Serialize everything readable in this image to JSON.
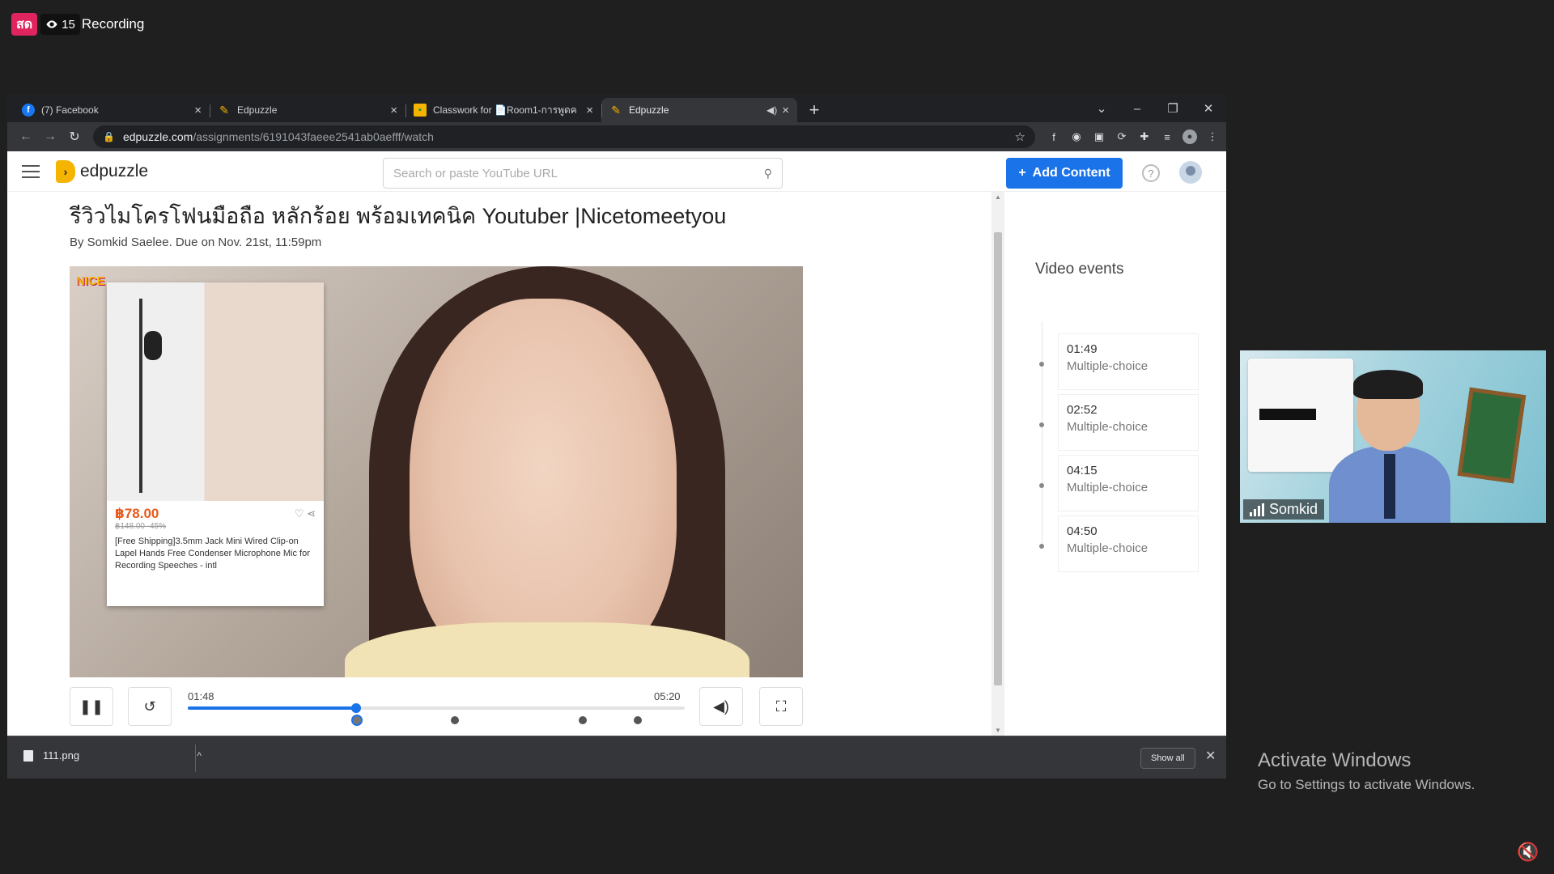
{
  "overlay": {
    "live_label": "สด",
    "viewer_count": "15",
    "recording_text": "Recording"
  },
  "browser": {
    "tabs": [
      {
        "label": "(7) Facebook",
        "favicon": "facebook-icon"
      },
      {
        "label": "Edpuzzle",
        "favicon": "edpuzzle-icon"
      },
      {
        "label": "Classwork for 📄Room1-การพูดค",
        "favicon": "google-classroom-icon"
      },
      {
        "label": "Edpuzzle",
        "favicon": "edpuzzle-icon",
        "active": true,
        "audio": true
      }
    ],
    "url_domain": "edpuzzle.com",
    "url_path": "/assignments/6191043faeee2541ab0aefff/watch"
  },
  "edpuzzle": {
    "logo_text": "edpuzzle",
    "search_placeholder": "Search or paste YouTube URL",
    "add_content_label": "Add Content",
    "help_label": "?",
    "video_title": "รีวิวไมโครโฟนมือถือ หลักร้อย พร้อมเทคนิค Youtuber |Nicetomeetyou",
    "byline": "By Somkid Saelee. Due on Nov. 21st, 11:59pm",
    "video_overlay": {
      "brand_text": "NICE",
      "price": "฿78.00",
      "old_price": "฿148.00 -45%",
      "product_desc": "[Free Shipping]3.5mm Jack Mini Wired Clip-on Lapel Hands Free Condenser Microphone Mic for Recording Speeches - intl"
    },
    "player": {
      "current_time": "01:48",
      "duration": "05:20",
      "progress_fraction": 0.338,
      "marker_fractions": [
        0.34,
        0.537,
        0.795,
        0.906
      ]
    },
    "video_events_title": "Video events",
    "events": [
      {
        "time": "01:49",
        "type": "Multiple-choice"
      },
      {
        "time": "02:52",
        "type": "Multiple-choice"
      },
      {
        "time": "04:15",
        "type": "Multiple-choice"
      },
      {
        "time": "04:50",
        "type": "Multiple-choice"
      }
    ]
  },
  "downloads": {
    "file_name": "111.png",
    "show_all_label": "Show all"
  },
  "webcam": {
    "participant_name": "Somkid"
  },
  "windows_notice": {
    "line1": "Activate Windows",
    "line2": "Go to Settings to activate Windows."
  }
}
